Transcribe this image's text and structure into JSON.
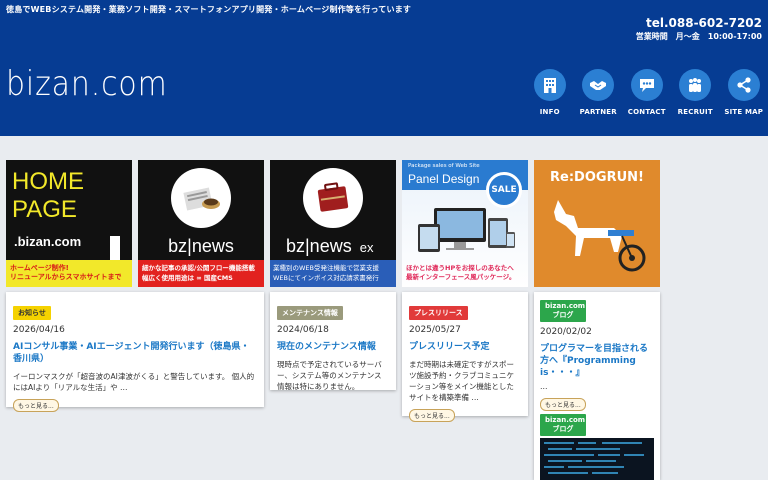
{
  "header": {
    "tagline": "徳島でWEBシステム開発・業務ソフト開発・スマートフォンアプリ開発・ホームページ制作等を行っています",
    "tel": "tel.088-602-7202",
    "hours": "営業時間　月〜金　10:00-17:00",
    "logo": "bizan.com",
    "nav": [
      {
        "label": "INFO",
        "icon": "building-icon"
      },
      {
        "label": "PARTNER",
        "icon": "handshake-icon"
      },
      {
        "label": "CONTACT",
        "icon": "chat-bubble-icon"
      },
      {
        "label": "RECRUIT",
        "icon": "people-icon"
      },
      {
        "label": "SITE MAP",
        "icon": "share-network-icon"
      }
    ]
  },
  "banners": {
    "homepage": {
      "line1": "HOME",
      "line2": "PAGE",
      "brand": ".bizan.com",
      "caption1": "ホームページ制作!",
      "caption2": "リニューアルからスマホサイトまで"
    },
    "bznews": {
      "title": "bz|news",
      "caption1": "細かな記事の承認/公開フロー機能搭載",
      "caption2": "幅広く使用用途は ∞ 国産CMS"
    },
    "bznewsex": {
      "title": "bz|news",
      "suffix": "ex",
      "caption1": "業種別のWEB受発注機能で営業支援",
      "caption2": "WEBにてインボイス対応請求書発行"
    },
    "panel": {
      "small": "Package sales of Web Site",
      "title": "Panel Design",
      "badge": "SALE",
      "caption1": "ほかとは違うHPをお探しのあなたへ",
      "caption2": "最新インターフェース風パッケージ。"
    },
    "redogrun": {
      "title": "Re:DOGRUN!"
    }
  },
  "posts": [
    {
      "tag": "お知らせ",
      "date": "2026/04/16",
      "title": "AIコンサル事業・AIエージェント開発行います（徳島県・香川県）",
      "excerpt": "イーロンマスクが「超音波のAI津波がくる」と警告しています。 個人的にはAIより「リアルな生活」や …",
      "more": "もっと見る..."
    },
    {
      "tag": "メンテナンス情報",
      "date": "2024/06/18",
      "title": "現在のメンテナンス情報",
      "excerpt": "現時点で予定されているサーバー、システム等のメンテナンス情報は特にありません。"
    },
    {
      "tag": "プレスリリース",
      "date": "2025/05/27",
      "title": "プレスリリース予定",
      "excerpt": "まだ時期は未確定ですがスポーツ施設予約・クラブコミュニケーション等をメイン機能としたサイトを構築準備 …",
      "more": "もっと見る..."
    },
    {
      "tag": "bizan.com ブログ",
      "date": "2020/02/02",
      "title": "プログラマーを目指される方へ『Programming is・・・』",
      "excerpt": "…",
      "more": "もっと見る..."
    }
  ],
  "blog2": {
    "tag": "bizan.com ブログ"
  },
  "colors": {
    "header_bg": "#063c93",
    "nav_circle": "#2b7fd3",
    "link": "#1b78c6",
    "tag_news": "#f5d200",
    "tag_maint": "#9a9a7c",
    "tag_press": "#e13a3a",
    "tag_blog": "#2ca64b"
  }
}
